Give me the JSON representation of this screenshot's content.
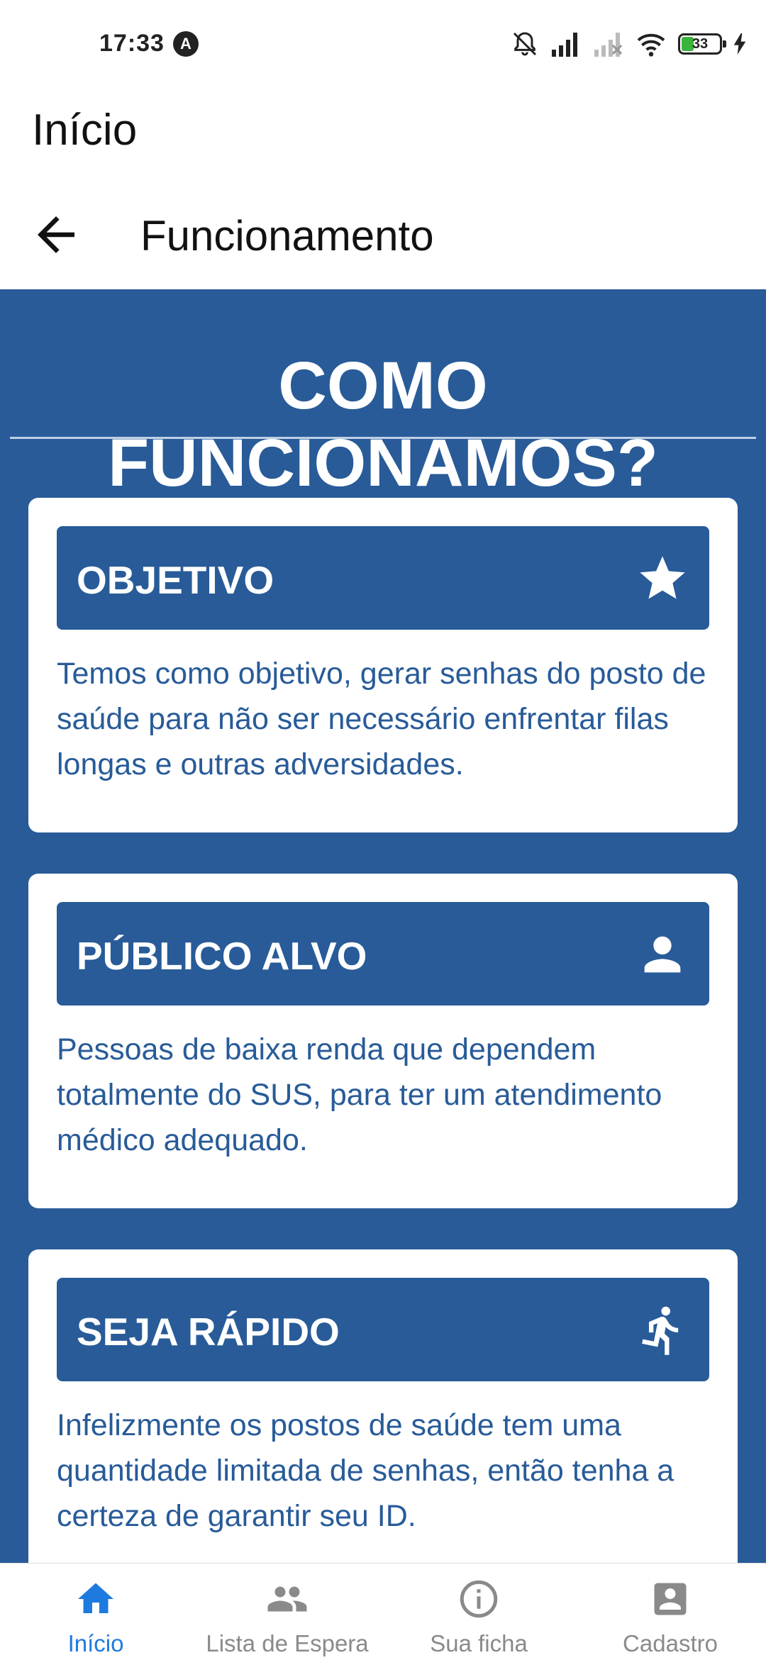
{
  "status_bar": {
    "time": "17:33",
    "app_icon": "A",
    "battery_level": "33"
  },
  "app_header": {
    "title": "Início"
  },
  "nav_header": {
    "title": "Funcionamento",
    "back_icon": "arrow-left-icon"
  },
  "main": {
    "headline": "COMO FUNCIONAMOS?",
    "cards": [
      {
        "title": "OBJETIVO",
        "icon": "star-icon",
        "text": "Temos como objetivo, gerar senhas do posto de saúde para não ser necessário enfrentar filas longas e outras adversidades."
      },
      {
        "title": "PÚBLICO ALVO",
        "icon": "person-icon",
        "text": "Pessoas de baixa renda que dependem totalmente do SUS, para ter um atendimento médico adequado."
      },
      {
        "title": "SEJA RÁPIDO",
        "icon": "running-person-icon",
        "text": "Infelizmente os postos de saúde tem uma quantidade limitada de senhas, então tenha a certeza de garantir seu ID."
      }
    ]
  },
  "bottom_nav": {
    "items": [
      {
        "label": "Início",
        "icon": "home-icon",
        "active": true
      },
      {
        "label": "Lista de Espera",
        "icon": "group-icon",
        "active": false
      },
      {
        "label": "Sua ficha",
        "icon": "info-icon",
        "active": false
      },
      {
        "label": "Cadastro",
        "icon": "account-box-icon",
        "active": false
      }
    ]
  },
  "colors": {
    "primary": "#285b98",
    "active_tab": "#1f7ae0",
    "inactive_tab": "#8a8a8a"
  }
}
